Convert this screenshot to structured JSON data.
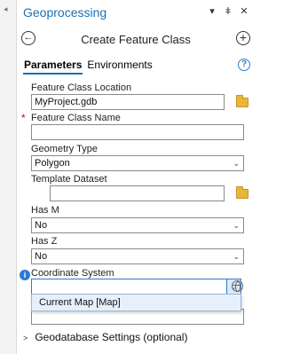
{
  "pane": {
    "title": "Geoprocessing",
    "icons": [
      "chevron-down-icon",
      "pin-icon",
      "close-icon"
    ]
  },
  "tool": {
    "name": "Create Feature Class"
  },
  "tabs": [
    {
      "label": "Parameters",
      "active": true
    },
    {
      "label": "Environments",
      "active": false
    }
  ],
  "params": {
    "location": {
      "label": "Feature Class Location",
      "value": "MyProject.gdb"
    },
    "name": {
      "label": "Feature Class Name",
      "value": "",
      "required_mark": "*"
    },
    "geometry": {
      "label": "Geometry Type",
      "value": "Polygon"
    },
    "template": {
      "label": "Template Dataset",
      "value": ""
    },
    "has_m": {
      "label": "Has M",
      "value": "No"
    },
    "has_z": {
      "label": "Has Z",
      "value": "No"
    },
    "coordinate": {
      "label": "Coordinate System",
      "value": ""
    }
  },
  "dropdown": {
    "items": [
      "Current Map [Map]"
    ]
  },
  "section": {
    "label": "Geodatabase Settings (optional)"
  },
  "colors": {
    "accent": "#1a6fb5",
    "required": "#d0021b",
    "info": "#2b7cd3"
  }
}
